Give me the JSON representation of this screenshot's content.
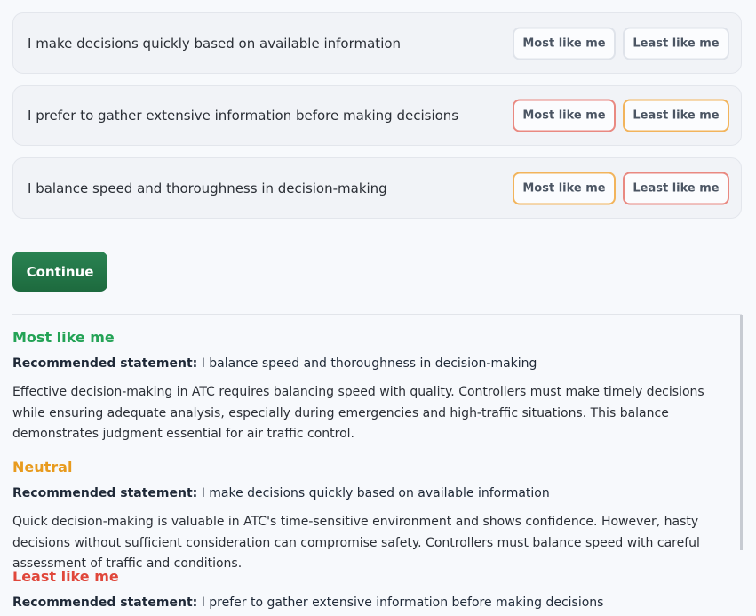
{
  "statements": [
    {
      "text": "I make decisions quickly based on available information",
      "most_label": "Most like me",
      "least_label": "Least like me"
    },
    {
      "text": "I prefer to gather extensive information before making decisions",
      "most_label": "Most like me",
      "least_label": "Least like me"
    },
    {
      "text": "I balance speed and thoroughness in decision-making",
      "most_label": "Most like me",
      "least_label": "Least like me"
    }
  ],
  "continue_label": "Continue",
  "feedback": [
    {
      "heading": "Most like me",
      "rec_label": "Recommended statement:",
      "rec_text": "I balance speed and thoroughness in decision-making",
      "explanation": "Effective decision-making in ATC requires balancing speed with quality. Controllers must make timely decisions while ensuring adequate analysis, especially during emergencies and high-traffic situations. This balance demonstrates judgment essential for air traffic control."
    },
    {
      "heading": "Neutral",
      "rec_label": "Recommended statement:",
      "rec_text": "I make decisions quickly based on available information",
      "explanation": "Quick decision-making is valuable in ATC's time-sensitive environment and shows confidence. However, hasty decisions without sufficient consideration can compromise safety. Controllers must balance speed with careful assessment of traffic and conditions."
    },
    {
      "heading": "Least like me",
      "rec_label": "Recommended statement:",
      "rec_text": "I prefer to gather extensive information before making decisions"
    }
  ],
  "colors": {
    "most": "#24a356",
    "neutral": "#e89b1e",
    "least": "#e0473b",
    "accent": "#1d6a3e"
  }
}
